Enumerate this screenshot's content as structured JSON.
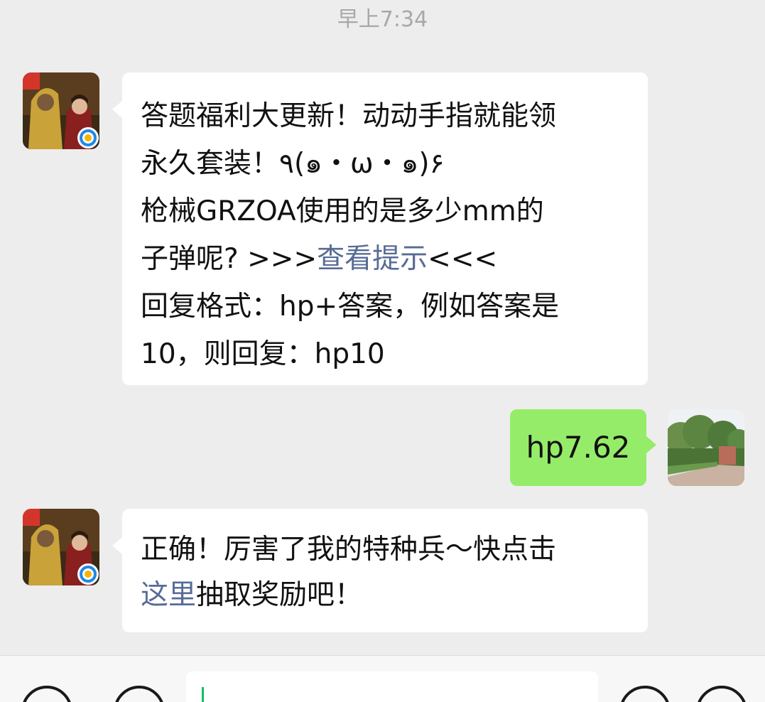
{
  "chat": {
    "timestamp": "早上7:34",
    "messages": [
      {
        "side": "left",
        "lines": [
          "答题福利大更新！动动手指就能领",
          "永久套装！٩(๑・ω・๑)۶",
          "枪械GRZOA使用的是多少mm的",
          {
            "before": "子弹呢? >>>",
            "link": "查看提示",
            "after": "<<<"
          },
          "回复格式：hp+答案，例如答案是",
          "10，则回复：hp10"
        ]
      },
      {
        "side": "right",
        "text": "hp7.62"
      },
      {
        "side": "left",
        "lines": [
          "正确！厉害了我的特种兵～快点击",
          {
            "link": "这里",
            "after": "抽取奖励吧！"
          }
        ]
      }
    ]
  },
  "colors": {
    "background": "#ededed",
    "bubble_left": "#ffffff",
    "bubble_right": "#95ec69",
    "link": "#576b95",
    "timestamp": "#a8a8a8",
    "caret": "#07c160"
  },
  "icons": {
    "left_avatar": "game-avatar-icon",
    "right_avatar": "user-avatar-icon",
    "voice": "voice-icon",
    "emoji": "emoji-icon",
    "more": "plus-icon"
  }
}
